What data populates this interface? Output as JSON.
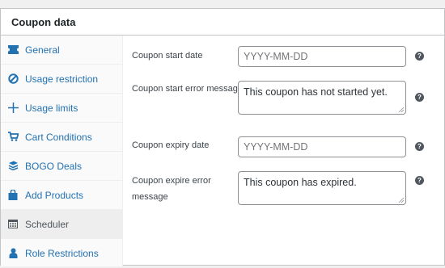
{
  "panel": {
    "title": "Coupon data"
  },
  "sidebar": {
    "items": [
      {
        "label": "General",
        "icon": "ticket-icon",
        "active": false
      },
      {
        "label": "Usage restriction",
        "icon": "block-icon",
        "active": false
      },
      {
        "label": "Usage limits",
        "icon": "move-icon",
        "active": false
      },
      {
        "label": "Cart Conditions",
        "icon": "cart-icon",
        "active": false
      },
      {
        "label": "BOGO Deals",
        "icon": "stack-icon",
        "active": false
      },
      {
        "label": "Add Products",
        "icon": "bag-icon",
        "active": false
      },
      {
        "label": "Scheduler",
        "icon": "calendar-icon",
        "active": true
      },
      {
        "label": "Role Restrictions",
        "icon": "user-icon",
        "active": false
      }
    ]
  },
  "fields": {
    "start_date": {
      "label": "Coupon start date",
      "placeholder": "YYYY-MM-DD"
    },
    "start_error": {
      "label": "Coupon start error message",
      "value": "This coupon has not started yet."
    },
    "expiry_date": {
      "label": "Coupon expiry date",
      "placeholder": "YYYY-MM-DD"
    },
    "expire_error": {
      "label_line1": "Coupon expire error",
      "label_line2": "message",
      "value": "This coupon has expired."
    }
  },
  "help": {
    "glyph": "?"
  },
  "colors": {
    "link": "#2271b1",
    "active_text": "#50575e",
    "active_bg": "#eeeeee",
    "border": "#c3c4c7"
  }
}
